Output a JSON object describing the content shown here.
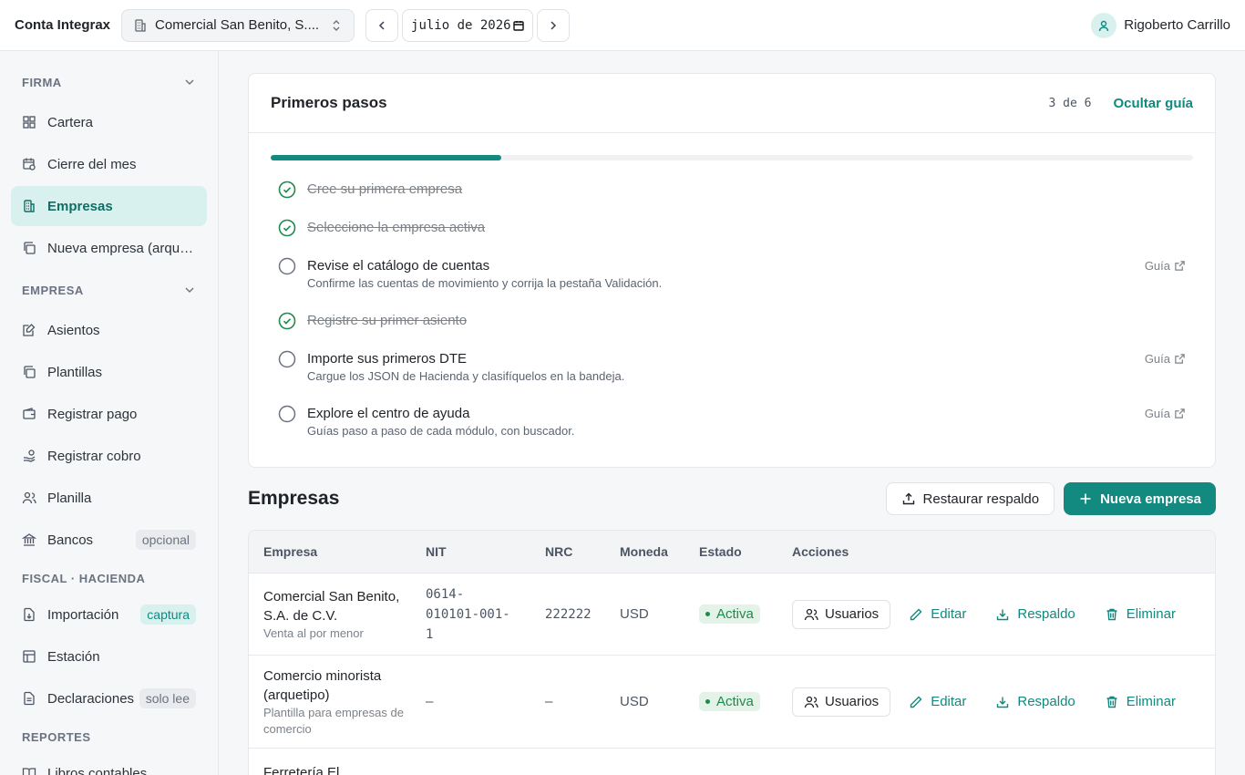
{
  "topbar": {
    "brand": "Conta Integrax",
    "company": "Comercial San Benito, S....",
    "month": "julio de 2026",
    "user": "Rigoberto Carrillo"
  },
  "sidebar": {
    "sections": {
      "firma": "FIRMA",
      "empresa": "EMPRESA",
      "fiscal": "FISCAL · HACIENDA",
      "reportes": "REPORTES"
    },
    "items": [
      {
        "label": "Cartera"
      },
      {
        "label": "Cierre del mes"
      },
      {
        "label": "Empresas"
      },
      {
        "label": "Nueva empresa (arquetipo)"
      },
      {
        "label": "Asientos"
      },
      {
        "label": "Plantillas"
      },
      {
        "label": "Registrar pago"
      },
      {
        "label": "Registrar cobro"
      },
      {
        "label": "Planilla"
      },
      {
        "label": "Bancos",
        "badge": "opcional"
      },
      {
        "label": "Importación",
        "badge": "captura"
      },
      {
        "label": "Estación"
      },
      {
        "label": "Declaraciones",
        "badge": "solo lee"
      },
      {
        "label": "Libros contables"
      }
    ]
  },
  "guide": {
    "title": "Primeros pasos",
    "count": "3 de 6",
    "completed": 3,
    "total": 6,
    "hide": "Ocultar guía",
    "guide_link": "Guía",
    "steps": [
      {
        "title": "Cree su primera empresa",
        "done": true
      },
      {
        "title": "Seleccione la empresa activa",
        "done": true
      },
      {
        "title": "Revise el catálogo de cuentas",
        "desc": "Confirme las cuentas de movimiento y corrija la pestaña Validación.",
        "done": false
      },
      {
        "title": "Registre su primer asiento",
        "done": true
      },
      {
        "title": "Importe sus primeros DTE",
        "desc": "Cargue los JSON de Hacienda y clasifíquelos en la bandeja.",
        "done": false
      },
      {
        "title": "Explore el centro de ayuda",
        "desc": "Guías paso a paso de cada módulo, con buscador.",
        "done": false
      }
    ]
  },
  "empresas": {
    "title": "Empresas",
    "restore": "Restaurar respaldo",
    "new": "Nueva empresa",
    "columns": [
      "Empresa",
      "NIT",
      "NRC",
      "Moneda",
      "Estado",
      "Acciones"
    ],
    "actions": {
      "users": "Usuarios",
      "edit": "Editar",
      "backup": "Respaldo",
      "delete": "Eliminar"
    },
    "rows": [
      {
        "name": "Comercial San Benito, S.A. de C.V.",
        "sub": "Venta al por menor",
        "nit": "0614-010101-001-1",
        "nrc": "222222",
        "moneda": "USD",
        "estado": "Activa"
      },
      {
        "name": "Comercio minorista (arquetipo)",
        "sub": "Plantilla para empresas de comercio",
        "nit": "—",
        "nrc": "—",
        "moneda": "USD",
        "estado": "Activa"
      },
      {
        "name": "Ferretería El",
        "sub": "",
        "nit": "",
        "nrc": "",
        "moneda": "",
        "estado": ""
      }
    ]
  },
  "colors": {
    "accent": "#138a80",
    "active_bg": "#d9f1ee",
    "status_green": "#1e8a4c"
  }
}
